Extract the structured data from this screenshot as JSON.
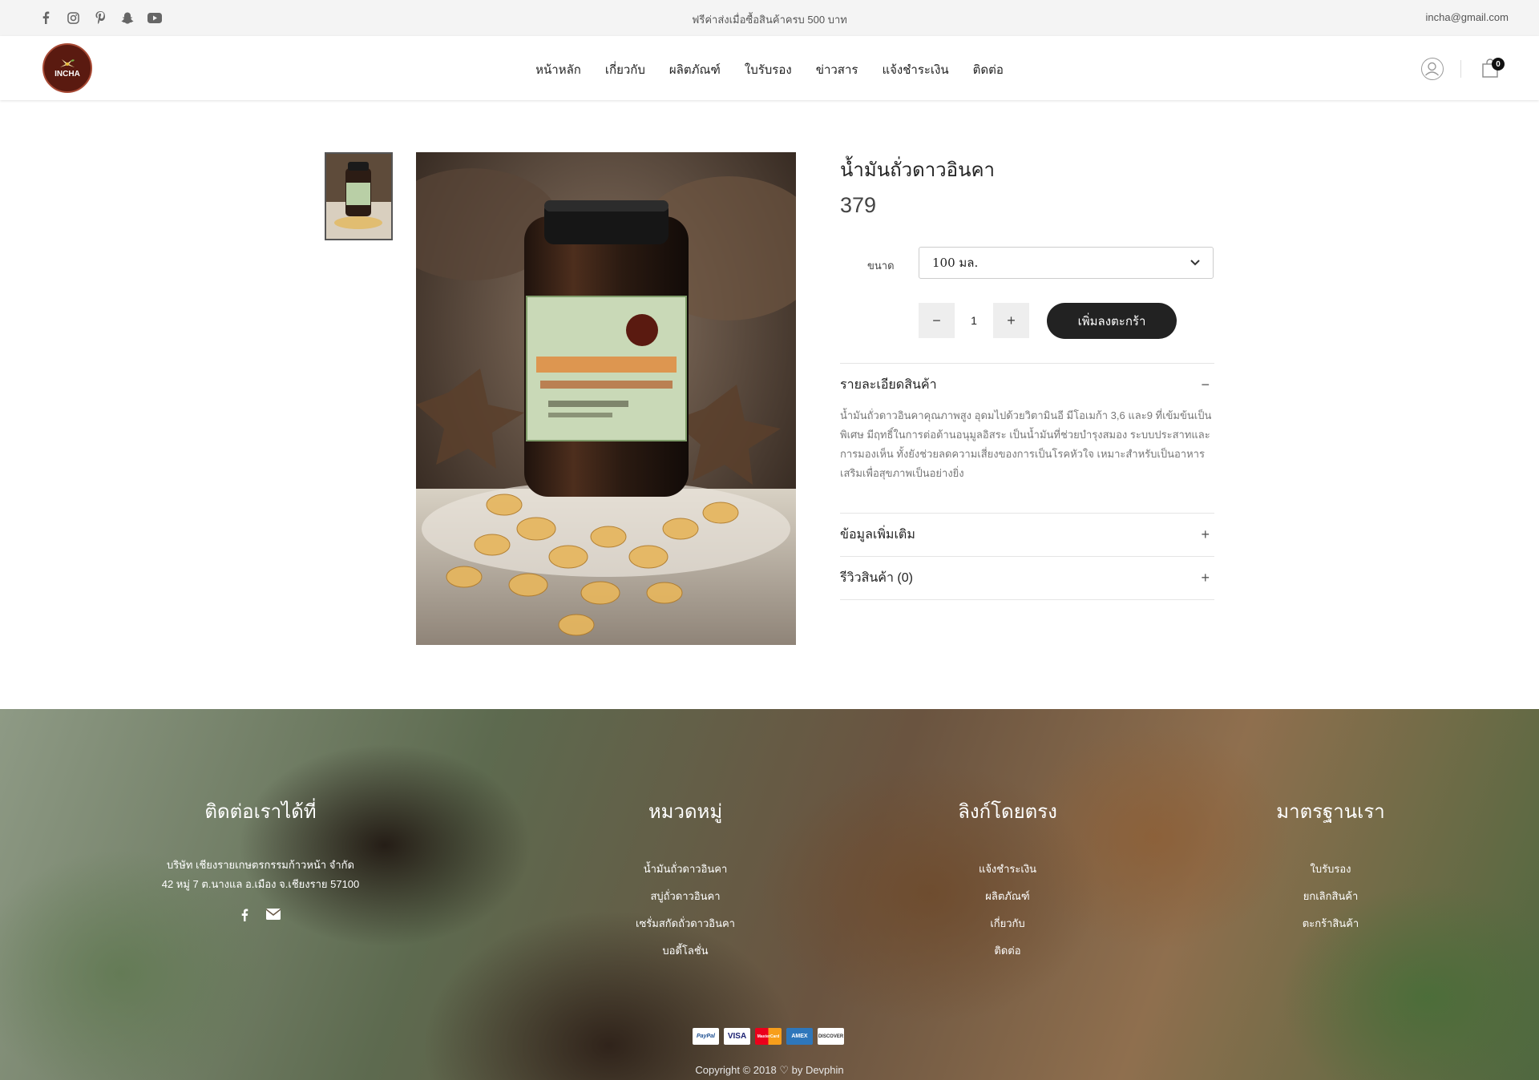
{
  "topbar": {
    "social_icons": [
      "facebook-icon",
      "instagram-icon",
      "pinterest-icon",
      "snapchat-icon",
      "youtube-icon"
    ],
    "promo": "ฟรีค่าส่งเมื่อซื้อสินค้าครบ 500 บาท",
    "email": "incha@gmail.com"
  },
  "header": {
    "logo_text": "INCHA",
    "nav": [
      "หน้าหลัก",
      "เกี่ยวกับ",
      "ผลิตภัณฑ์",
      "ใบรับรอง",
      "ข่าวสาร",
      "แจ้งชำระเงิน",
      "ติดต่อ"
    ],
    "cart_count": "0"
  },
  "product": {
    "name": "น้ำมันถั่วดาวอินคา",
    "price": "379",
    "size_label": "ขนาด",
    "size_value": "100 มล.",
    "qty_minus": "−",
    "qty_value": "1",
    "qty_plus": "+",
    "add_to_cart": "เพิ่มลงตะกร้า",
    "accordion": [
      {
        "title": "รายละเอียดสินค้า",
        "sign": "−",
        "body": "น้ำมันถั่วดาวอินคาคุณภาพสูง อุดมไปด้วยวิตามินอี มีโอเมก้า 3,6 และ9 ที่เข้มข้นเป็นพิเศษ มีฤทธิ์ในการต่อต้านอนุมูลอิสระ เป็นน้ำมันที่ช่วยบำรุงสมอง ระบบประสาทและการมองเห็น ทั้งยังช่วยลดความเสี่ยงของการเป็นโรคหัวใจ เหมาะสำหรับเป็นอาหารเสริมเพื่อสุขภาพเป็นอย่างยิ่ง"
      },
      {
        "title": "ข้อมูลเพิ่มเติม",
        "sign": "+"
      },
      {
        "title": "รีวิวสินค้า (0)",
        "sign": "+"
      }
    ]
  },
  "footer": {
    "contact": {
      "title": "ติดต่อเราได้ที่",
      "line1": "บริษัท เชียงรายเกษตรกรรมก้าวหน้า จำกัด",
      "line2": "42 หมู่ 7 ต.นางแล อ.เมือง จ.เชียงราย 57100"
    },
    "categories": {
      "title": "หมวดหมู่",
      "items": [
        "น้ำมันถั่วดาวอินคา",
        "สบู่ถั่วดาวอินคา",
        "เซรั่มสกัดถั่วดาวอินคา",
        "บอดี้โลชั่น"
      ]
    },
    "links": {
      "title": "ลิงก์โดยตรง",
      "items": [
        "แจ้งชำระเงิน",
        "ผลิตภัณฑ์",
        "เกี่ยวกับ",
        "ติดต่อ"
      ]
    },
    "standards": {
      "title": "มาตรฐานเรา",
      "items": [
        "ใบรับรอง",
        "ยกเลิกสินค้า",
        "ตะกร้าสินค้า"
      ]
    },
    "payments": [
      "PayPal",
      "VISA",
      "MasterCard",
      "AMEX",
      "DISCOVER"
    ],
    "copyright": "Copyright © 2018 ♡ by Devphin"
  }
}
